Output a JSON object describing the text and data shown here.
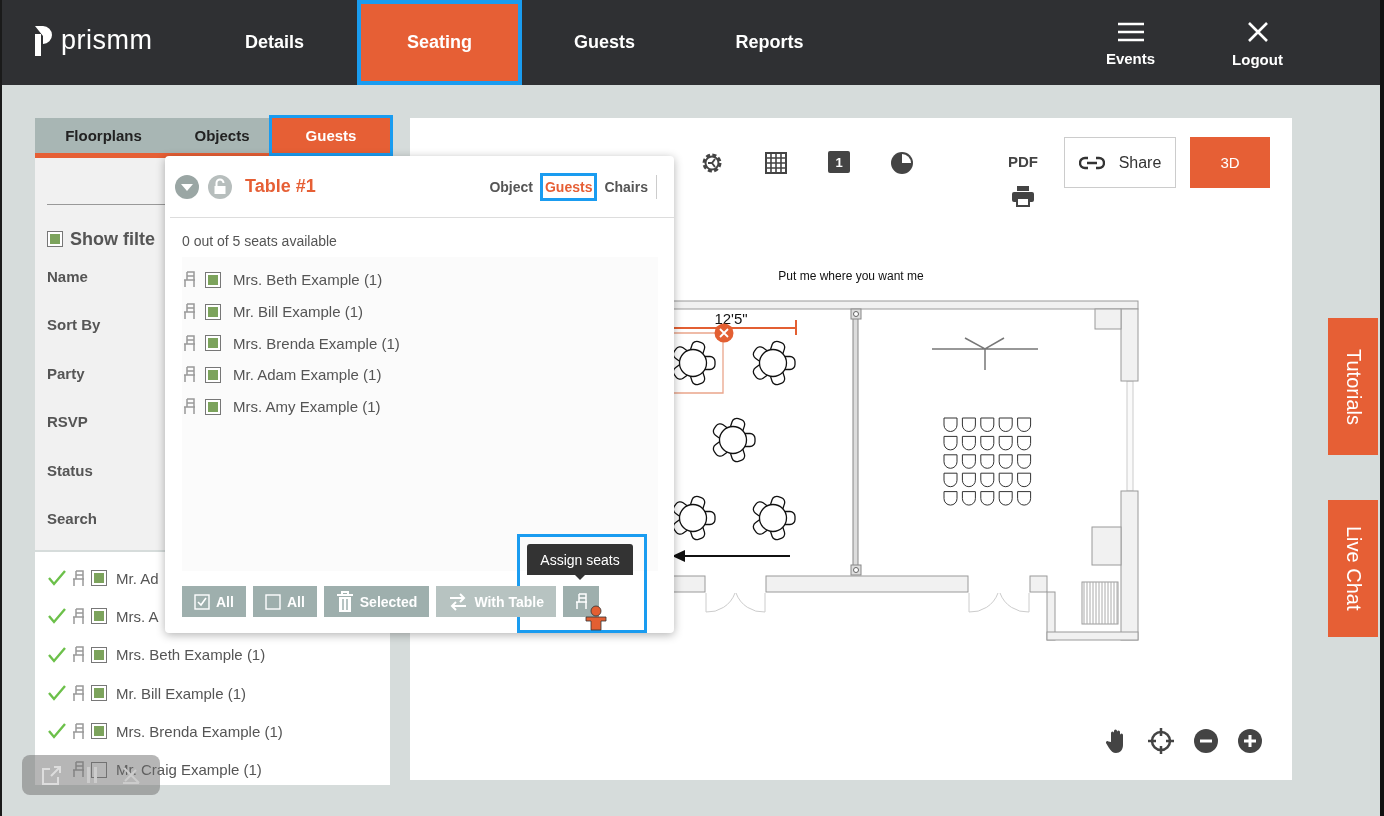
{
  "app": {
    "logo": "prismm"
  },
  "nav": [
    {
      "label": "Details",
      "selected": false,
      "highlighted": false
    },
    {
      "label": "Seating",
      "selected": true,
      "highlighted": true
    },
    {
      "label": "Guests",
      "selected": false,
      "highlighted": false
    },
    {
      "label": "Reports",
      "selected": false,
      "highlighted": false
    }
  ],
  "nav_actions": [
    {
      "kind": "menu",
      "label": "Events"
    },
    {
      "kind": "close",
      "label": "Logout"
    }
  ],
  "left_panel": {
    "tabs": [
      {
        "label": "Floorplans",
        "selected": false,
        "highlighted": false
      },
      {
        "label": "Objects",
        "selected": false,
        "highlighted": false
      },
      {
        "label": "Guests",
        "selected": true,
        "highlighted": true
      }
    ],
    "show_filters": {
      "label": "Show filte",
      "checked": true
    },
    "filters": [
      "Name",
      "Sort By",
      "Party",
      "RSVP",
      "Status",
      "Search"
    ],
    "guests": [
      {
        "name": "Mr. Ad",
        "seated": true,
        "checked": true
      },
      {
        "name": "Mrs. A",
        "seated": true,
        "checked": true
      },
      {
        "name": "Mrs. Beth Example (1)",
        "seated": true,
        "checked": true
      },
      {
        "name": "Mr. Bill Example (1)",
        "seated": true,
        "checked": true
      },
      {
        "name": "Mrs. Brenda Example (1)",
        "seated": true,
        "checked": true
      },
      {
        "name": "Mr. Craig Example (1)",
        "seated": false,
        "checked": false
      }
    ]
  },
  "popup": {
    "title": "Table #1",
    "tabs": [
      {
        "label": "Object",
        "selected": false,
        "highlighted": false
      },
      {
        "label": "Guests",
        "selected": true,
        "highlighted": true
      },
      {
        "label": "Chairs",
        "selected": false,
        "highlighted": false
      }
    ],
    "availability": "0 out of 5 seats available",
    "guests": [
      {
        "name": "Mrs. Beth Example (1)",
        "checked": true
      },
      {
        "name": "Mr. Bill Example (1)",
        "checked": true
      },
      {
        "name": "Mrs. Brenda Example (1)",
        "checked": true
      },
      {
        "name": "Mr. Adam Example (1)",
        "checked": true
      },
      {
        "name": "Mrs. Amy Example (1)",
        "checked": true
      }
    ],
    "actions": [
      {
        "kind": "select_all",
        "label": "All",
        "disabled": false,
        "highlighted": false
      },
      {
        "kind": "deselect_all",
        "label": "All",
        "disabled": false,
        "highlighted": false
      },
      {
        "kind": "delete",
        "label": "Selected",
        "disabled": false,
        "highlighted": false
      },
      {
        "kind": "swap",
        "label": "With Table",
        "disabled": true,
        "highlighted": false
      },
      {
        "kind": "assign",
        "disabled": false,
        "highlighted": true,
        "tooltip": "Assign seats"
      }
    ]
  },
  "canvas": {
    "level_badge": "1",
    "pdf": "PDF",
    "share": "Share",
    "view_3d": "3D",
    "hint": "Put me where you want me",
    "dimension": "12'5\""
  },
  "side_tabs": [
    "Tutorials",
    "Live Chat"
  ]
}
